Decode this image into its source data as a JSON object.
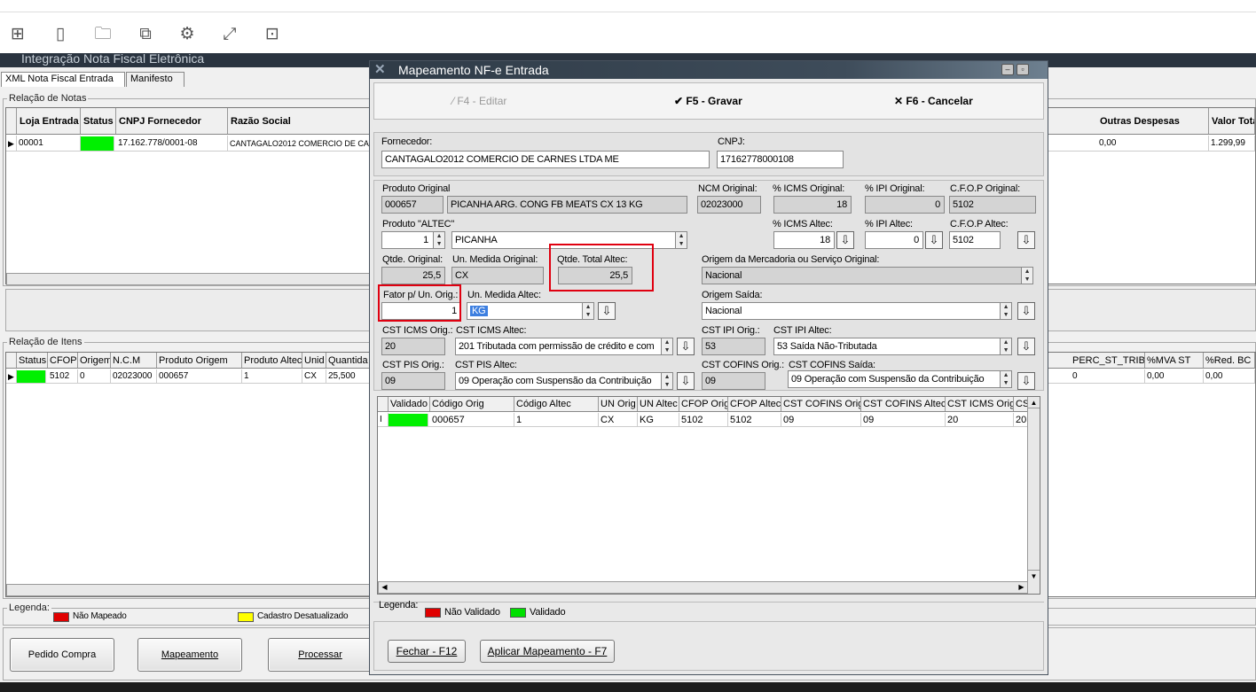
{
  "toolbar": {
    "icons": [
      "grid-icon",
      "panels-icon",
      "folder-icon",
      "copy-icon",
      "gear-icon",
      "expand-icon",
      "devices-icon"
    ]
  },
  "background_window": {
    "title": "Integração Nota Fiscal Eletrônica",
    "tabs": [
      "XML Nota Fiscal Entrada",
      "Manifesto"
    ],
    "notas_group": "Relação de Notas",
    "notas_columns": [
      "Loja Entrada",
      "Status",
      "CNPJ Fornecedor",
      "Razão Social",
      "Outras Despesas",
      "Valor Total"
    ],
    "notas_row": {
      "loja": "00001",
      "cnpj": "17.162.778/0001-08",
      "razao": "CANTAGALO2012 COMERCIO DE CA",
      "outras": "0,00",
      "valor": "1.299,99"
    },
    "itens_group": "Relação de Itens",
    "itens_columns": [
      "Status",
      "CFOP",
      "Origem",
      "N.C.M",
      "Produto Origem",
      "Produto Altec",
      "Unid",
      "Quantida",
      "PERC_ST_TRIB",
      "%MVA ST",
      "%Red. BC S"
    ],
    "itens_row": {
      "cfop": "5102",
      "origem": "0",
      "ncm": "02023000",
      "produto_origem": "000657",
      "produto_altec": "1",
      "unid": "CX",
      "quantidade": "25,500",
      "perc": "0",
      "mva": "0,00",
      "red": "0,00"
    },
    "legend_label": "Legenda:",
    "legend_items": [
      {
        "label": "Não Mapeado",
        "color": "#e00000"
      },
      {
        "label": "Cadastro Desatualizado",
        "color": "#ffff00"
      }
    ],
    "buttons": [
      "Pedido Compra",
      "Mapeamento",
      "Processar"
    ]
  },
  "dialog": {
    "title": "Mapeamento NF-e Entrada",
    "commands": {
      "edit": "F4 - Editar",
      "save": "F5 - Gravar",
      "cancel": "F6 - Cancelar"
    },
    "fornecedor_label": "Fornecedor:",
    "fornecedor_value": "CANTAGALO2012 COMERCIO DE CARNES LTDA ME",
    "cnpj_label": "CNPJ:",
    "cnpj_value": "17162778000108",
    "produto_original_label": "Produto Original",
    "produto_original_code": "000657",
    "produto_original_desc": "PICANHA ARG. CONG FB MEATS CX 13 KG",
    "ncm_original_label": "NCM Original:",
    "ncm_original_value": "02023000",
    "icms_original_label": "% ICMS Original:",
    "icms_original_value": "18",
    "ipi_original_label": "% IPI Original:",
    "ipi_original_value": "0",
    "cfop_original_label": "C.F.O.P Original:",
    "cfop_original_value": "5102",
    "produto_altec_label": "Produto \"ALTEC\"",
    "produto_altec_code": "1",
    "produto_altec_desc": "PICANHA",
    "icms_altec_label": "% ICMS Altec:",
    "icms_altec_value": "18",
    "ipi_altec_label": "% IPI Altec:",
    "ipi_altec_value": "0",
    "cfop_altec_label": "C.F.O.P Altec:",
    "cfop_altec_value": "5102",
    "qtde_original_label": "Qtde. Original:",
    "qtde_original_value": "25,5",
    "un_original_label": "Un. Medida Original:",
    "un_original_value": "CX",
    "qtde_total_label": "Qtde. Total Altec:",
    "qtde_total_value": "25,5",
    "origem_merc_label": "Origem da Mercadoria ou Serviço Original:",
    "origem_merc_value": "Nacional",
    "fator_label": "Fator p/ Un. Orig.:",
    "fator_value": "1",
    "un_altec_label": "Un. Medida Altec:",
    "un_altec_value": "KG",
    "origem_saida_label": "Origem Saída:",
    "origem_saida_value": "Nacional",
    "cst_icms_orig_label": "CST ICMS Orig.:",
    "cst_icms_orig_value": "20",
    "cst_icms_altec_label": "CST ICMS Altec:",
    "cst_icms_altec_value": "201 Tributada com permissão de crédito e com",
    "cst_ipi_orig_label": "CST IPI Orig.:",
    "cst_ipi_orig_value": "53",
    "cst_ipi_altec_label": "CST IPI Altec:",
    "cst_ipi_altec_value": "53 Saída Não-Tributada",
    "cst_pis_orig_label": "CST PIS Orig.:",
    "cst_pis_orig_value": "09",
    "cst_pis_altec_label": "CST PIS Altec:",
    "cst_pis_altec_value": "09 Operação com Suspensão da Contribuição",
    "cst_cofins_orig_label": "CST COFINS Orig.:",
    "cst_cofins_orig_value": "09",
    "cst_cofins_saida_label": "CST COFINS Saída:",
    "cst_cofins_saida_value": "09 Operação com Suspensão da Contribuição",
    "grid_columns": [
      "Validado",
      "Código Orig",
      "Código Altec",
      "UN Orig",
      "UN Altec",
      "CFOP Orig",
      "CFOP Altec",
      "CST COFINS Orig",
      "CST COFINS Altec",
      "CST ICMS Orig",
      "CS"
    ],
    "grid_row": {
      "codigo_orig": "000657",
      "codigo_altec": "1",
      "un_orig": "CX",
      "un_altec": "KG",
      "cfop_orig": "5102",
      "cfop_altec": "5102",
      "cofins_orig": "09",
      "cofins_altec": "09",
      "icms_orig": "20",
      "cs": "20"
    },
    "legend_label": "Legenda:",
    "legend_items": [
      {
        "label": "Não Validado",
        "color": "#e00000"
      },
      {
        "label": "Validado",
        "color": "#00e000"
      }
    ],
    "buttons": {
      "close": "Fechar - F12",
      "apply": "Aplicar Mapeamento - F7"
    }
  }
}
